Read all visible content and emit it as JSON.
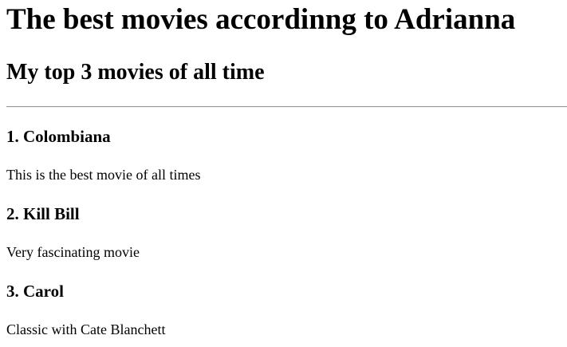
{
  "header": {
    "title": "The best movies accordinng to Adrianna",
    "subtitle": "My top 3 movies of all time"
  },
  "movies": [
    {
      "title": "1. Colombiana",
      "description": "This is the best movie of all times"
    },
    {
      "title": "2. Kill Bill",
      "description": "Very fascinating movie"
    },
    {
      "title": "3. Carol",
      "description": "Classic with Cate Blanchett"
    }
  ]
}
